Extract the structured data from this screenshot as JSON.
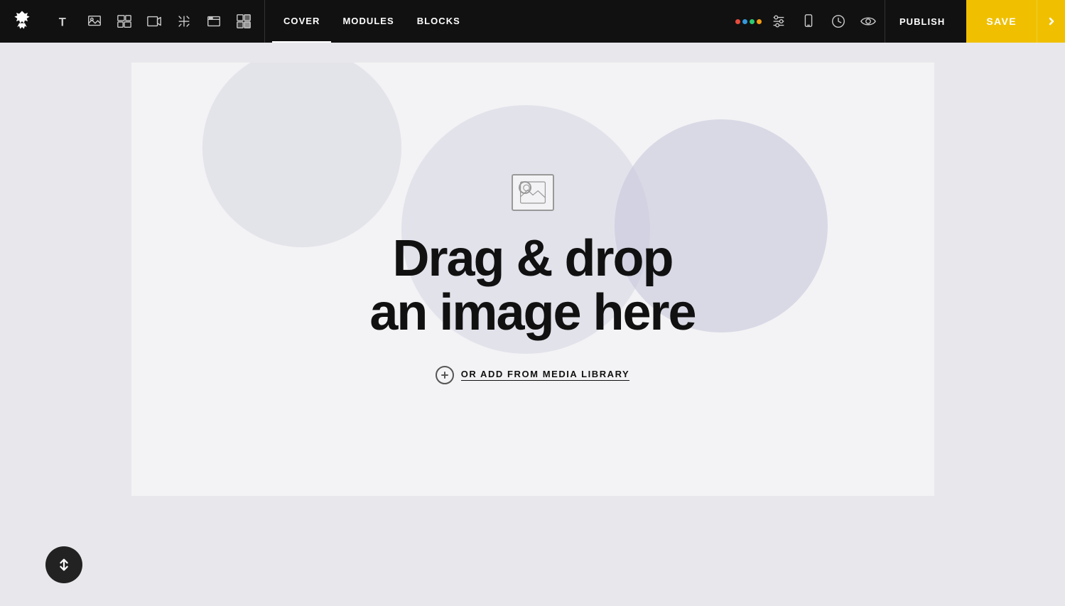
{
  "toolbar": {
    "logo_alt": "Brand logo",
    "tools": [
      {
        "name": "text-tool",
        "label": "Text"
      },
      {
        "name": "image-tool",
        "label": "Image"
      },
      {
        "name": "gallery-tool",
        "label": "Gallery"
      },
      {
        "name": "video-tool",
        "label": "Video"
      },
      {
        "name": "layout-tool",
        "label": "Layout"
      },
      {
        "name": "embed-tool",
        "label": "Embed"
      },
      {
        "name": "halftone-tool",
        "label": "Halftone"
      }
    ],
    "nav": [
      {
        "id": "cover",
        "label": "COVER",
        "active": true
      },
      {
        "id": "modules",
        "label": "MODULES",
        "active": false
      },
      {
        "id": "blocks",
        "label": "BLOCKS",
        "active": false
      }
    ],
    "right_tools": [
      {
        "name": "color-palette-btn",
        "label": "Color palette"
      },
      {
        "name": "settings-btn",
        "label": "Settings"
      },
      {
        "name": "mobile-btn",
        "label": "Mobile preview"
      },
      {
        "name": "history-btn",
        "label": "History"
      },
      {
        "name": "preview-btn",
        "label": "Preview"
      }
    ],
    "publish_label": "PUBLISH",
    "save_label": "SAVE"
  },
  "canvas": {
    "drag_drop_line1": "Drag & drop",
    "drag_drop_line2": "an image here",
    "media_library_label": "OR ADD FROM MEDIA LIBRARY"
  },
  "colors": {
    "toolbar_bg": "#111111",
    "save_bg": "#f0c000",
    "canvas_bg": "#f0f0f2",
    "page_bg": "#f3f3f5"
  }
}
